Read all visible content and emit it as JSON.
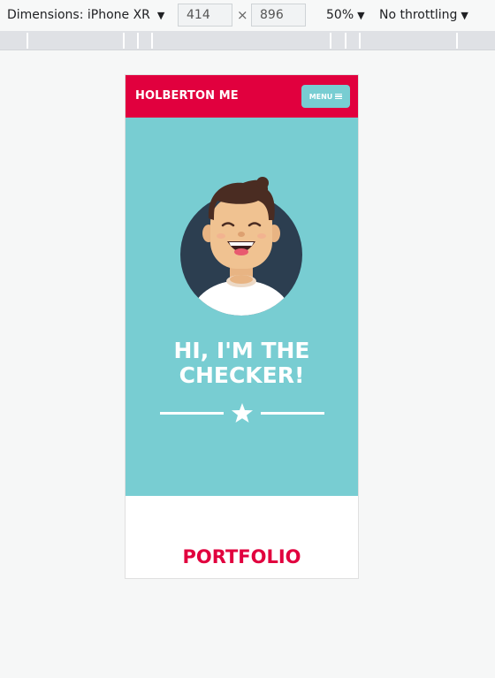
{
  "devtools": {
    "dimensions_label": "Dimensions: iPhone XR",
    "width_value": "414",
    "height_value": "896",
    "times_symbol": "×",
    "zoom_label": "50%",
    "throttle_label": "No throttling",
    "caret": "▼"
  },
  "site": {
    "brand": "HOLBERTON ME",
    "menu_label": "MENU",
    "hero_title_line1": "HI, I'M THE",
    "hero_title_line2": "CHECKER!",
    "portfolio_title": "PORTFOLIO"
  },
  "colors": {
    "accent_red": "#e1003e",
    "hero_teal": "#78cdd2",
    "avatar_bg": "#2c3e50"
  },
  "icons": [
    "caret-down-icon",
    "hamburger-icon",
    "star-icon",
    "avatar-illustration"
  ]
}
